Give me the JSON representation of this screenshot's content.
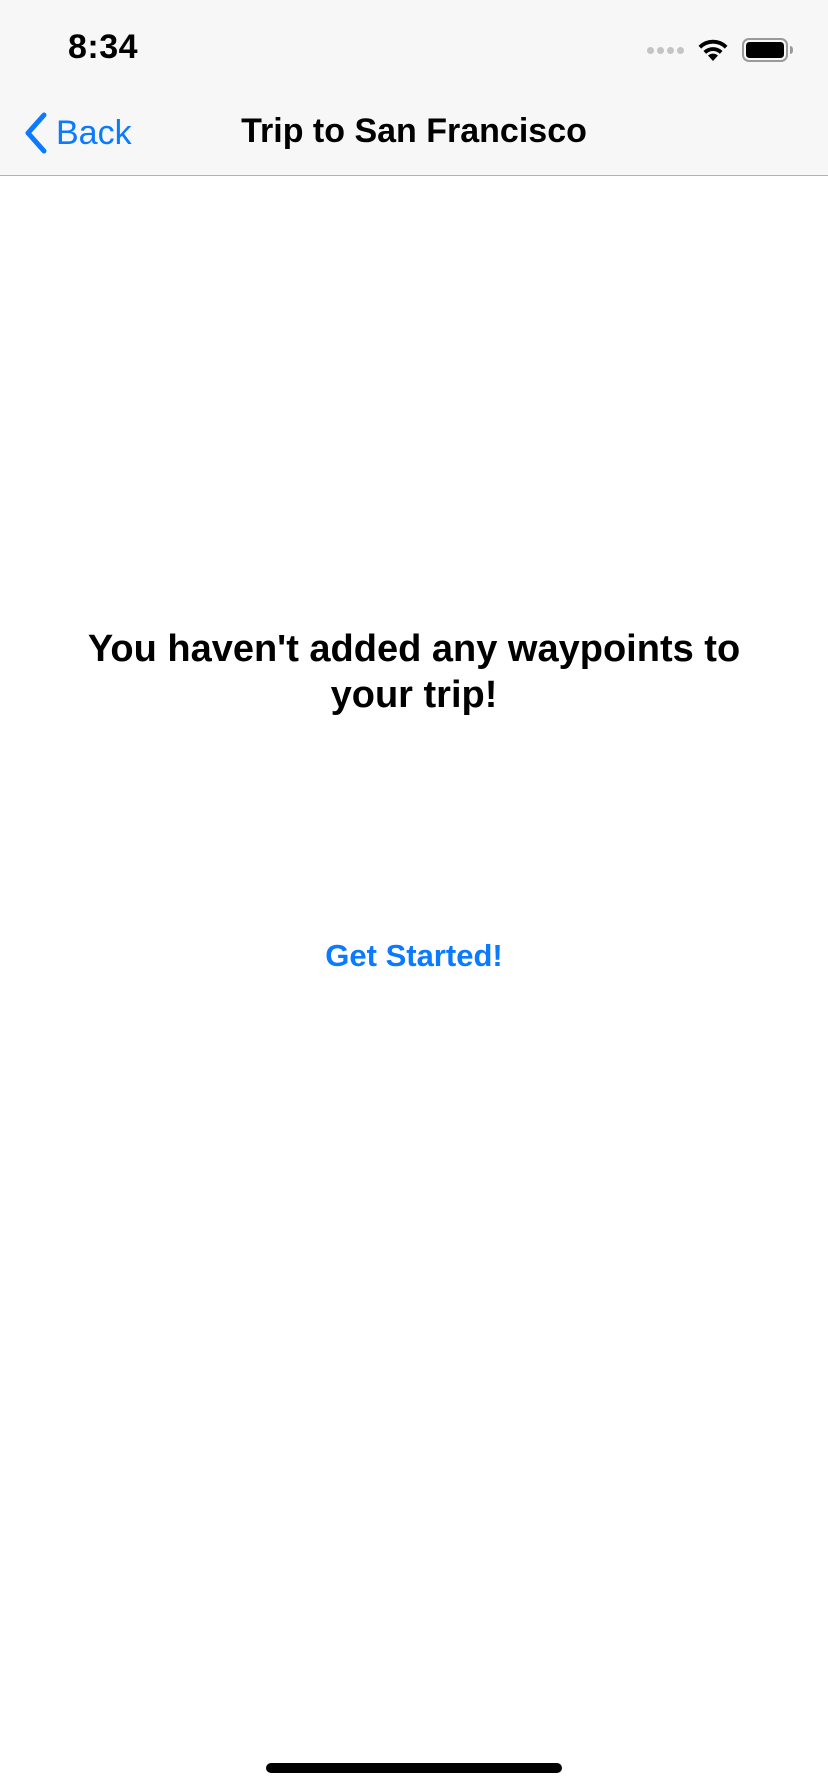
{
  "status_bar": {
    "time": "8:34"
  },
  "nav": {
    "back_label": "Back",
    "title": "Trip to San Francisco"
  },
  "content": {
    "empty_message": "You haven't added any waypoints to your trip!",
    "get_started_label": "Get Started!"
  },
  "icons": {
    "back": "chevron-left-icon",
    "signal": "cellular-signal-icon",
    "wifi": "wifi-icon",
    "battery": "battery-icon"
  },
  "colors": {
    "accent": "#0a7aff",
    "nav_background": "#f7f7f7",
    "text": "#000000"
  }
}
